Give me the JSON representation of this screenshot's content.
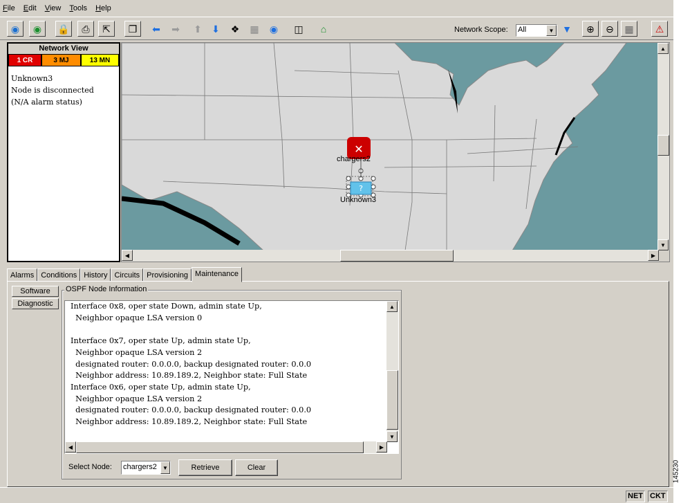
{
  "menu": [
    "File",
    "Edit",
    "View",
    "Tools",
    "Help"
  ],
  "toolbar": {
    "network_scope_label": "Network Scope:",
    "network_scope_value": "All"
  },
  "network_view": {
    "title": "Network View",
    "alarms": [
      {
        "label": "1 CR",
        "color": "#e00000",
        "text_color": "#ffffff"
      },
      {
        "label": "3 MJ",
        "color": "#ff8c00",
        "text_color": "#000000"
      },
      {
        "label": "13 MN",
        "color": "#ffff00",
        "text_color": "#000000"
      }
    ],
    "info_lines": [
      "Unknown3",
      "Node is disconnected",
      "(N/A alarm status)"
    ]
  },
  "map": {
    "node_primary": "chargers2",
    "node_secondary": "Unknown3",
    "land_color": "#d9d9d9",
    "water_color": "#6b9aa0",
    "critical_color": "#cc0000"
  },
  "tabs": [
    "Alarms",
    "Conditions",
    "History",
    "Circuits",
    "Provisioning",
    "Maintenance"
  ],
  "active_tab": "Maintenance",
  "maintenance": {
    "side_buttons": [
      "Software",
      "Diagnostic"
    ],
    "legend": "OSPF Node Information",
    "lines": [
      "Interface 0x8, oper state Down, admin state Up,",
      "  Neighbor opaque LSA version 0",
      "",
      "Interface 0x7, oper state Up, admin state Up,",
      "  Neighbor opaque LSA version 2",
      "  designated router: 0.0.0.0, backup designated router: 0.0.0",
      "  Neighbor address: 10.89.189.2, Neighbor state: Full State",
      "Interface 0x6, oper state Up, admin state Up,",
      "  Neighbor opaque LSA version 2",
      "  designated router: 0.0.0.0, backup designated router: 0.0.0",
      "  Neighbor address: 10.89.189.2, Neighbor state: Full State"
    ],
    "select_node_label": "Select Node:",
    "select_node_value": "chargers2",
    "retrieve_label": "Retrieve",
    "clear_label": "Clear"
  },
  "status": {
    "net": "NET",
    "ckt": "CKT"
  },
  "figure_number": "145230"
}
